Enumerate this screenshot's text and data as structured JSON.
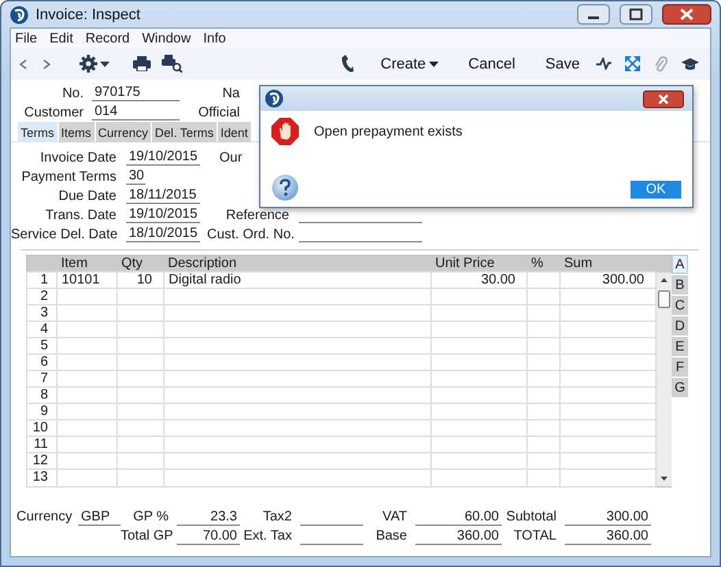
{
  "window": {
    "title": "Invoice: Inspect"
  },
  "menu": [
    "File",
    "Edit",
    "Record",
    "Window",
    "Info"
  ],
  "toolbar": {
    "buttons": [
      {
        "label": "Create",
        "kind": "dropdown"
      },
      {
        "label": "Cancel",
        "kind": "plain"
      },
      {
        "label": "Save",
        "kind": "plain"
      }
    ]
  },
  "header": {
    "rows": [
      {
        "label": "No.",
        "value": "970175",
        "side_label": "Na"
      },
      {
        "label": "Customer",
        "value": "014",
        "side_label": "Official"
      }
    ]
  },
  "tabs": [
    {
      "label": "Terms",
      "selected": true
    },
    {
      "label": "Items",
      "selected": false
    },
    {
      "label": "Currency",
      "selected": false
    },
    {
      "label": "Del. Terms",
      "selected": false
    },
    {
      "label": "Ident",
      "selected": false
    }
  ],
  "terms": {
    "rows": [
      {
        "label": "Invoice Date",
        "value": "19/10/2015",
        "kind": "date",
        "side": {
          "label": "Our",
          "kind": "label"
        }
      },
      {
        "label": "Payment Terms",
        "value": "30",
        "kind": "short"
      },
      {
        "label": "Due Date",
        "value": "18/11/2015",
        "kind": "date"
      },
      {
        "label": "Trans. Date",
        "value": "19/10/2015",
        "kind": "date",
        "side": {
          "label": "Reference",
          "kind": "text_field"
        }
      },
      {
        "label": "Service Del. Date",
        "value": "18/10/2015",
        "kind": "date",
        "side": {
          "label": "Cust. Ord. No.",
          "kind": "text_field"
        }
      }
    ]
  },
  "items": {
    "columns": [
      "Item",
      "Qty",
      "Description",
      "Unit Price",
      "%",
      "Sum"
    ],
    "rows": [
      {
        "number": "1",
        "item": "10101",
        "qty": "10",
        "description": "Digital radio",
        "unit_price": "30.00",
        "sum": "300.00"
      },
      {
        "number": "2"
      },
      {
        "number": "3"
      },
      {
        "number": "4"
      },
      {
        "number": "5"
      },
      {
        "number": "6"
      },
      {
        "number": "7"
      },
      {
        "number": "8"
      },
      {
        "number": "9"
      },
      {
        "number": "10"
      },
      {
        "number": "11"
      },
      {
        "number": "12"
      },
      {
        "number": "13"
      }
    ],
    "side_tabs": [
      {
        "label": "A",
        "selected": true
      },
      {
        "label": "B",
        "selected": false
      },
      {
        "label": "C",
        "selected": false
      },
      {
        "label": "D",
        "selected": false
      },
      {
        "label": "E",
        "selected": false
      },
      {
        "label": "F",
        "selected": false
      },
      {
        "label": "G",
        "selected": false
      }
    ]
  },
  "totals": {
    "groups": [
      [
        {
          "label": "Currency",
          "value": "GBP",
          "kind": "text"
        }
      ],
      [
        {
          "label": "GP %",
          "value": "23.3",
          "kind": "number"
        },
        {
          "label": "Total GP",
          "value": "70.00",
          "kind": "number"
        }
      ],
      [
        {
          "label": "Tax2",
          "kind": "number"
        },
        {
          "label": "Ext. Tax",
          "kind": "number"
        }
      ],
      [
        {
          "label": "VAT",
          "value": "60.00",
          "kind": "number"
        },
        {
          "label": "Base",
          "value": "360.00",
          "kind": "number"
        }
      ],
      [
        {
          "label": "Subtotal",
          "value": "300.00",
          "kind": "number"
        },
        {
          "label": "TOTAL",
          "value": "360.00",
          "kind": "number"
        }
      ]
    ]
  },
  "dialog": {
    "message": "Open prepayment exists",
    "button": "OK"
  }
}
